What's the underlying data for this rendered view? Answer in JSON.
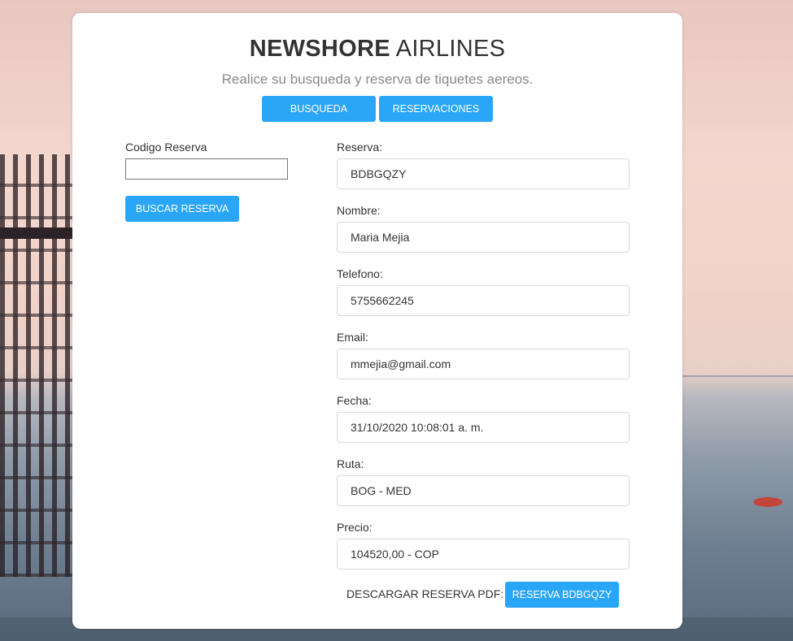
{
  "header": {
    "title_bold": "NEWSHORE",
    "title_light": "AIRLINES",
    "subtitle": "Realice su busqueda y reserva de tiquetes aereos."
  },
  "nav": {
    "tabs": [
      {
        "label": "BUSQUEDA"
      },
      {
        "label": "RESERVACIONES"
      }
    ]
  },
  "search": {
    "label": "Codigo Reserva",
    "value": "",
    "placeholder": "",
    "button_label": "BUSCAR RESERVA"
  },
  "reservation": {
    "fields": [
      {
        "label": "Reserva:",
        "value": "BDBGQZY"
      },
      {
        "label": "Nombre:",
        "value": "Maria Mejia"
      },
      {
        "label": "Telefono:",
        "value": "5755662245"
      },
      {
        "label": "Email:",
        "value": "mmejia@gmail.com"
      },
      {
        "label": "Fecha:",
        "value": "31/10/2020 10:08:01 a. m."
      },
      {
        "label": "Ruta:",
        "value": "BOG - MED"
      },
      {
        "label": "Precio:",
        "value": "104520,00 - COP"
      }
    ],
    "download_label": "DESCARGAR RESERVA PDF:",
    "download_button": "RESERVA BDBGQZY"
  },
  "colors": {
    "accent": "#2aa6f8",
    "text": "#333333",
    "muted": "#8a8a8a",
    "card": "#ffffff"
  }
}
